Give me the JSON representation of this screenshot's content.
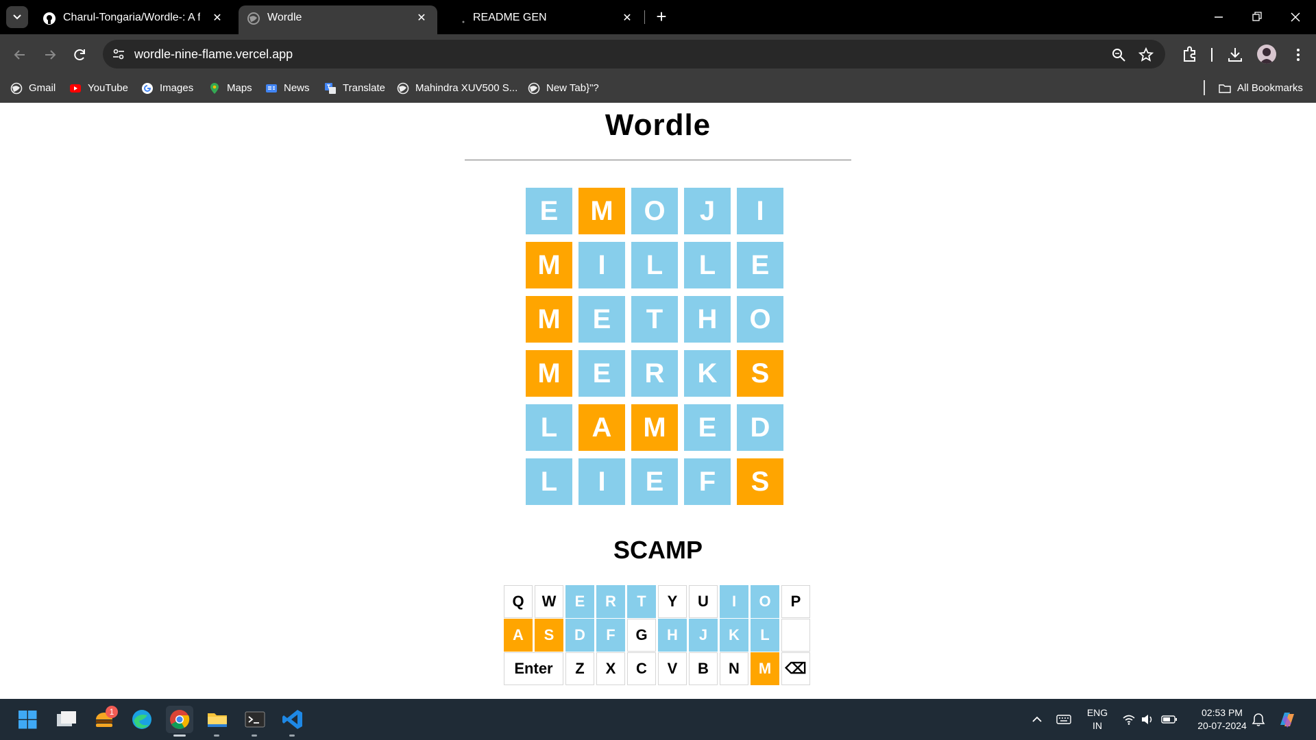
{
  "browser": {
    "tabs": [
      {
        "title": "Charul-Tongaria/Wordle-: A fun",
        "icon": "github-icon",
        "active": false
      },
      {
        "title": "Wordle",
        "icon": "globe-icon",
        "active": true
      },
      {
        "title": "README GEN",
        "icon": "loading-icon",
        "active": false
      }
    ],
    "url": "wordle-nine-flame.vercel.app",
    "bookmarks": [
      {
        "label": "Gmail",
        "icon": "globe-icon"
      },
      {
        "label": "YouTube",
        "icon": "youtube-icon"
      },
      {
        "label": "Images",
        "icon": "google-icon"
      },
      {
        "label": "Maps",
        "icon": "maps-pin-icon"
      },
      {
        "label": "News",
        "icon": "news-icon"
      },
      {
        "label": "Translate",
        "icon": "translate-icon"
      },
      {
        "label": "Mahindra XUV500 S...",
        "icon": "globe-icon"
      },
      {
        "label": "New Tab}\"?",
        "icon": "globe-icon"
      }
    ],
    "all_bookmarks_label": "All Bookmarks"
  },
  "game": {
    "title": "Wordle",
    "answer": "SCAMP",
    "colors": {
      "present": "#FFA500",
      "absent": "#87CEEB",
      "key_default": "#FFFFFF"
    },
    "guesses": [
      {
        "letters": [
          "E",
          "M",
          "O",
          "J",
          "I"
        ],
        "states": [
          "absent",
          "present",
          "absent",
          "absent",
          "absent"
        ]
      },
      {
        "letters": [
          "M",
          "I",
          "L",
          "L",
          "E"
        ],
        "states": [
          "present",
          "absent",
          "absent",
          "absent",
          "absent"
        ]
      },
      {
        "letters": [
          "M",
          "E",
          "T",
          "H",
          "O"
        ],
        "states": [
          "present",
          "absent",
          "absent",
          "absent",
          "absent"
        ]
      },
      {
        "letters": [
          "M",
          "E",
          "R",
          "K",
          "S"
        ],
        "states": [
          "present",
          "absent",
          "absent",
          "absent",
          "present"
        ]
      },
      {
        "letters": [
          "L",
          "A",
          "M",
          "E",
          "D"
        ],
        "states": [
          "absent",
          "present",
          "present",
          "absent",
          "absent"
        ]
      },
      {
        "letters": [
          "L",
          "I",
          "E",
          "F",
          "S"
        ],
        "states": [
          "absent",
          "absent",
          "absent",
          "absent",
          "present"
        ]
      }
    ],
    "keyboard": [
      [
        {
          "k": "Q",
          "s": "none"
        },
        {
          "k": "W",
          "s": "none"
        },
        {
          "k": "E",
          "s": "absent"
        },
        {
          "k": "R",
          "s": "absent"
        },
        {
          "k": "T",
          "s": "absent"
        },
        {
          "k": "Y",
          "s": "none"
        },
        {
          "k": "U",
          "s": "none"
        },
        {
          "k": "I",
          "s": "absent"
        },
        {
          "k": "O",
          "s": "absent"
        },
        {
          "k": "P",
          "s": "none"
        }
      ],
      [
        {
          "k": "A",
          "s": "present"
        },
        {
          "k": "S",
          "s": "present"
        },
        {
          "k": "D",
          "s": "absent"
        },
        {
          "k": "F",
          "s": "absent"
        },
        {
          "k": "G",
          "s": "none"
        },
        {
          "k": "H",
          "s": "absent"
        },
        {
          "k": "J",
          "s": "absent"
        },
        {
          "k": "K",
          "s": "absent"
        },
        {
          "k": "L",
          "s": "absent"
        },
        {
          "k": "",
          "s": "none"
        }
      ],
      [
        {
          "k": "Enter",
          "s": "none"
        },
        {
          "k": "Z",
          "s": "none"
        },
        {
          "k": "X",
          "s": "none"
        },
        {
          "k": "C",
          "s": "none"
        },
        {
          "k": "V",
          "s": "none"
        },
        {
          "k": "B",
          "s": "none"
        },
        {
          "k": "N",
          "s": "none"
        },
        {
          "k": "M",
          "s": "present"
        },
        {
          "k": "⌫",
          "s": "none"
        }
      ]
    ]
  },
  "taskbar": {
    "apps": [
      "windows-start-icon",
      "task-view-icon",
      "burger-app-icon",
      "edge-icon",
      "chrome-icon",
      "file-explorer-icon",
      "terminal-icon",
      "vscode-icon"
    ],
    "notification_badge": "1",
    "language": "ENG",
    "region": "IN",
    "time": "02:53 PM",
    "date": "20-07-2024"
  }
}
